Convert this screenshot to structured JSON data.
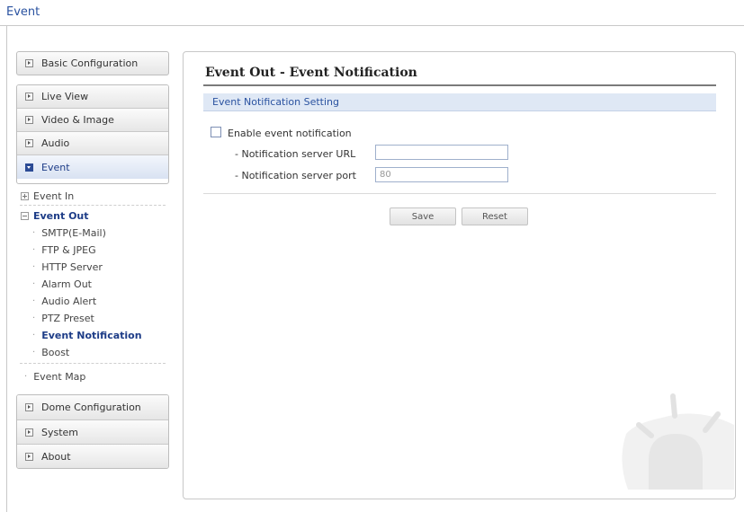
{
  "topbar": {
    "title": "Event"
  },
  "sidebar": {
    "basic_configuration": "Basic Configuration",
    "group_items": [
      {
        "label": "Live View"
      },
      {
        "label": "Video & Image"
      },
      {
        "label": "Audio"
      },
      {
        "label": "Event"
      }
    ],
    "submenu": {
      "event_in": "Event In",
      "event_out": "Event Out",
      "event_out_items": [
        "SMTP(E-Mail)",
        "FTP & JPEG",
        "HTTP Server",
        "Alarm Out",
        "Audio Alert",
        "PTZ Preset",
        "Event Notification",
        "Boost"
      ],
      "event_map": "Event Map"
    },
    "bottom_items": [
      {
        "label": "Dome Configuration"
      },
      {
        "label": "System"
      },
      {
        "label": "About"
      }
    ]
  },
  "main": {
    "title": "Event Out - Event Notification",
    "section": "Event Notification Setting",
    "enable_label": "Enable event notification",
    "enable_checked": false,
    "url_label": "- Notification server URL",
    "url_value": "",
    "port_label": "- Notification server port",
    "port_value": "80",
    "save_label": "Save",
    "reset_label": "Reset"
  },
  "colors": {
    "accent": "#2a52a0",
    "section_bg": "#dfe8f5",
    "active_item": "#1d3c87"
  },
  "icons": {
    "expand": "expand-arrow-icon",
    "collapse": "collapse-arrow-icon",
    "tree_plus": "tree-plus-icon",
    "tree_minus": "tree-minus-icon",
    "watermark": "alarm-light-icon"
  }
}
